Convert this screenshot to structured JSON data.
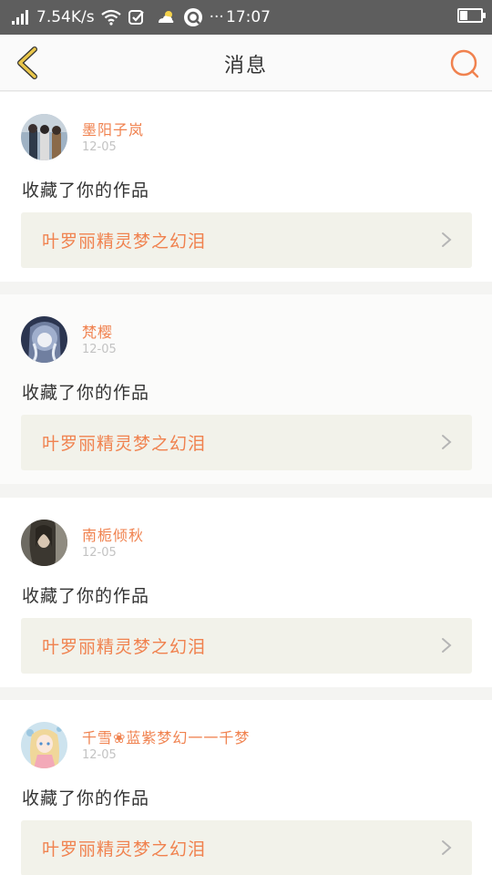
{
  "status_bar": {
    "speed": "7.54K/s",
    "time": "17:07",
    "more": "···"
  },
  "header": {
    "title": "消息"
  },
  "messages": [
    {
      "user": "墨阳子岚",
      "date": "12-05",
      "action": "收藏了你的作品",
      "work_title": "叶罗丽精灵梦之幻泪"
    },
    {
      "user": "梵樱",
      "date": "12-05",
      "action": "收藏了你的作品",
      "work_title": "叶罗丽精灵梦之幻泪"
    },
    {
      "user": "南栀倾秋",
      "date": "12-05",
      "action": "收藏了你的作品",
      "work_title": "叶罗丽精灵梦之幻泪"
    },
    {
      "user": "千雪❀蓝紫梦幻一一千梦",
      "date": "12-05",
      "action": "收藏了你的作品",
      "work_title": "叶罗丽精灵梦之幻泪"
    }
  ],
  "colors": {
    "accent": "#f0824f",
    "back_arrow": "#e9c64a",
    "status_bar": "#5e5e5e"
  }
}
